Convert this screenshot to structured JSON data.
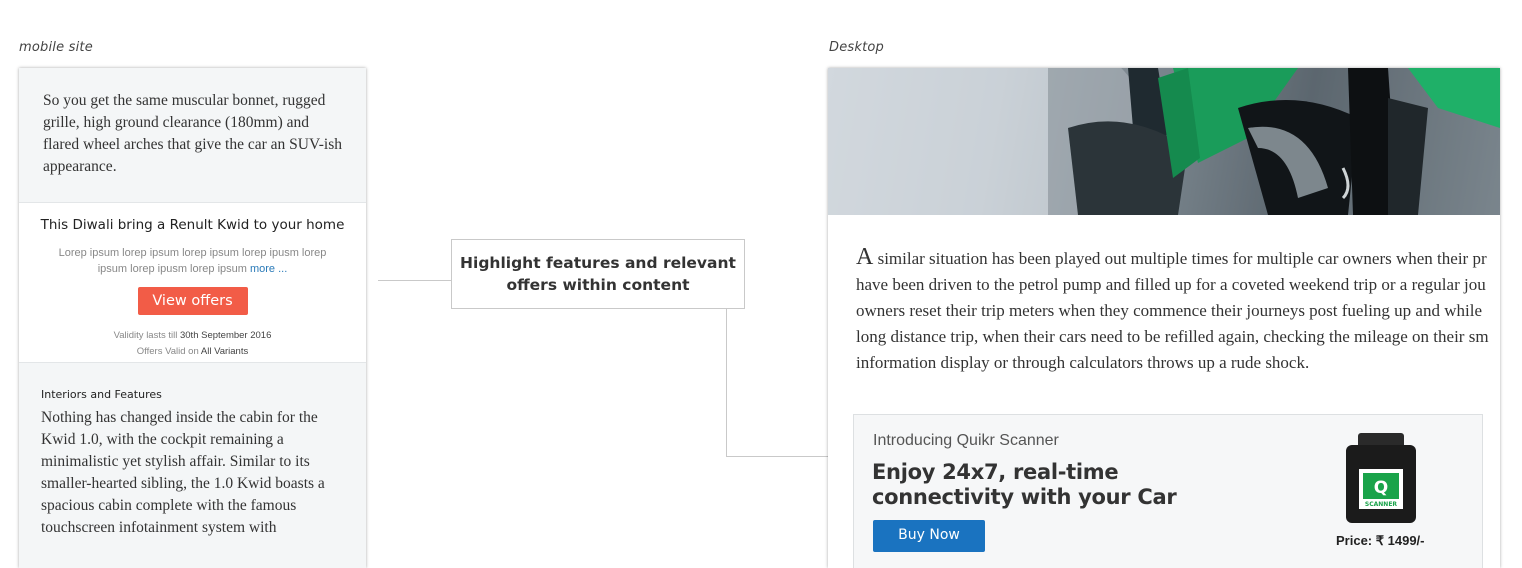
{
  "labels": {
    "mobile": "mobile site",
    "desktop": "Desktop"
  },
  "mobile": {
    "intro_text": "So you get the same muscular bonnet, rugged grille, high ground clearance (180mm) and flared wheel arches that give the car an SUV-ish appearance.",
    "offer": {
      "title": "This Diwali bring a Renult Kwid to your home",
      "text": "Lorep ipsum lorep ipsum lorep ipsum lorep ipusm lorep ipsum lorep ipusm lorep ipsum",
      "more": "more ...",
      "button": "View offers",
      "validity_label": "Validity lasts till",
      "validity_value": "30th September 2016",
      "valid_on_label": "Offers Valid on",
      "valid_on_value": "All Variants"
    },
    "interiors": {
      "title": "Interiors and Features",
      "body": "Nothing has changed inside the cabin for the Kwid 1.0, with the cockpit remaining a minimalistic yet stylish affair. Similar to its smaller-hearted sibling, the 1.0 Kwid boasts a spacious cabin complete with the famous touchscreen infotainment system with"
    }
  },
  "callout": {
    "text": "Highlight features and relevant offers within content"
  },
  "desktop": {
    "drop_cap": "A",
    "lines": [
      " similar situation has been played out multiple times for multiple car owners when their pr",
      "have been driven to the petrol pump and filled up for a coveted weekend trip or a regular jou",
      "owners reset their trip meters when they commence their journeys post fueling up and while",
      "long distance trip, when their cars need to be refilled again, checking the mileage on their sm",
      "information display or through calculators throws up a rude shock."
    ],
    "promo": {
      "intro": "Introducing Quikr Scanner",
      "headline": "Enjoy 24x7, real-time connectivity with your Car",
      "button": "Buy Now",
      "device_letter": "Q",
      "device_label": "SCANNER",
      "price": "Price: ₹ 1499/-"
    }
  },
  "colors": {
    "offer_button": "#f25c47",
    "buy_button": "#1a73c0",
    "nozzle_green": "#1a9c5a"
  }
}
